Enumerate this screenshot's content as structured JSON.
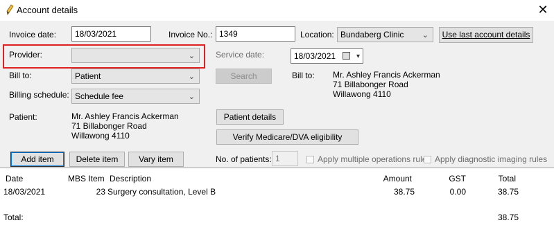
{
  "window": {
    "title": "Account details",
    "close": "✕"
  },
  "labels": {
    "invoice_date": "Invoice date:",
    "invoice_no": "Invoice No.:",
    "location": "Location:",
    "provider": "Provider:",
    "service_date": "Service date:",
    "bill_to": "Bill to:",
    "bill_to_right": "Bill to:",
    "billing_schedule": "Billing schedule:",
    "patient": "Patient:",
    "no_of_patients": "No. of patients:"
  },
  "fields": {
    "invoice_date": "18/03/2021",
    "invoice_no": "1349",
    "location": "Bundaberg Clinic",
    "provider": "",
    "service_date": "18/03/2021",
    "bill_to": "Patient",
    "billing_schedule": "Schedule fee",
    "no_of_patients": "1"
  },
  "buttons": {
    "use_last": "Use last account details",
    "search": "Search",
    "patient_details": "Patient details",
    "verify": "Verify Medicare/DVA eligibility",
    "add_item": "Add item",
    "delete_item": "Delete item",
    "vary_item": "Vary item"
  },
  "checkboxes": {
    "apply_multiple": "Apply multiple operations rule",
    "apply_diagnostic": "Apply diagnostic imaging rules"
  },
  "patient_address": [
    "Mr. Ashley Francis Ackerman",
    "71 Billabonger Road",
    "Willawong  4110"
  ],
  "bill_to_address": [
    "Mr. Ashley Francis Ackerman",
    "71 Billabonger Road",
    "Willawong 4110"
  ],
  "table": {
    "headers": {
      "date": "Date",
      "mbs": "MBS Item",
      "description": "Description",
      "amount": "Amount",
      "gst": "GST",
      "total": "Total"
    },
    "rows": [
      {
        "date": "18/03/2021",
        "mbs": "23",
        "description": "Surgery consultation, Level B",
        "amount": "38.75",
        "gst": "0.00",
        "total": "38.75"
      }
    ],
    "footer": {
      "label": "Total:",
      "total": "38.75"
    }
  },
  "icons": {
    "title": "pen-icon",
    "combo_arrow": "chevron-down-icon",
    "calendar": "calendar-icon"
  },
  "colors": {
    "highlight": "#e02020",
    "focus": "#0078d7"
  }
}
